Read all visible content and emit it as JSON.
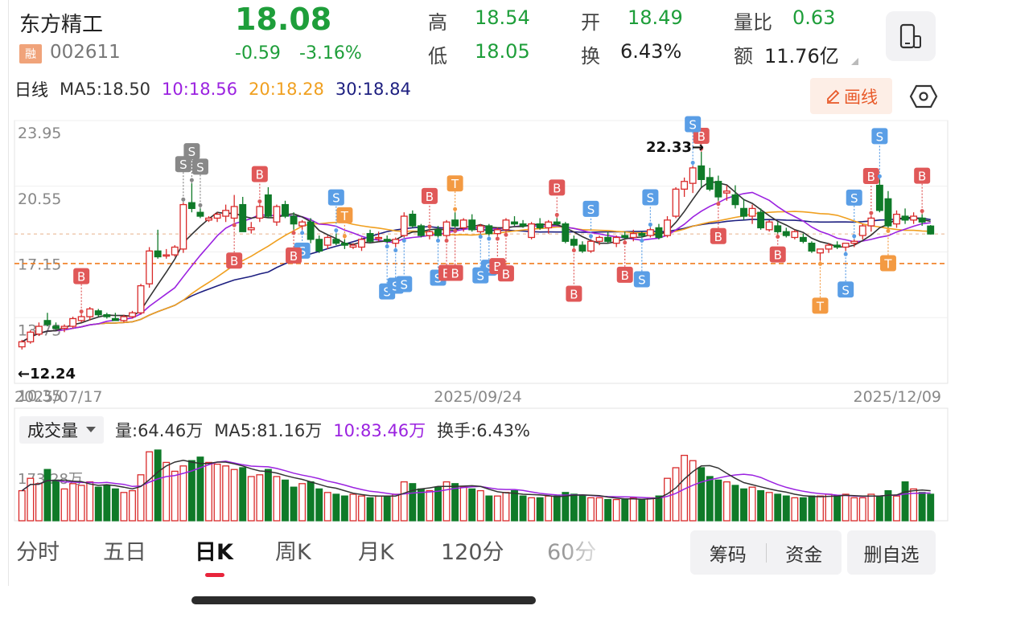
{
  "header": {
    "stock_name": "东方精工",
    "badge": "融",
    "stock_code": "002611",
    "price": "18.08",
    "change": "-0.59",
    "change_pct": "-3.16%",
    "high_label": "高",
    "high": "18.54",
    "low_label": "低",
    "low": "18.05",
    "open_label": "开",
    "open": "18.49",
    "turnover_label": "换",
    "turnover": "6.43%",
    "vol_ratio_label": "量比",
    "vol_ratio": "0.63",
    "amount_label": "额",
    "amount": "11.76亿"
  },
  "ma": {
    "period_label": "日线",
    "ma5": "MA5:18.50",
    "ma10": "10:18.56",
    "ma20": "20:18.28",
    "ma30": "30:18.84"
  },
  "toolbar": {
    "draw_label": "画线"
  },
  "kchart": {
    "y_labels": [
      "23.95",
      "20.55",
      "17.15",
      "13.75",
      "10.35"
    ],
    "max_label": "22.33→",
    "min_label": "←12.24",
    "dates": [
      "2025/07/17",
      "2025/09/24",
      "2025/12/09"
    ]
  },
  "volume": {
    "select_label": "成交量",
    "vol": "量:64.46万",
    "ma5": "MA5:81.16万",
    "ma10": "10:83.46万",
    "turnover": "换手:6.43%",
    "y_label": "173.28万"
  },
  "tabs": [
    "分时",
    "五日",
    "日K",
    "周K",
    "月K",
    "120分",
    "60分"
  ],
  "active_tab": "日K",
  "buttons": {
    "chips": "筹码",
    "funds": "资金",
    "remove_watch": "删自选"
  },
  "colors": {
    "up": "#d92a2a",
    "down": "#0f7a28",
    "ma5": "#333333",
    "ma10": "#9b22e0",
    "ma20": "#f0a020",
    "ma30": "#1d1f80",
    "buy": "#e05858",
    "sell": "#5a9ee6",
    "t": "#f39a42"
  },
  "chart_data": {
    "type": "candlestick",
    "x_start": "2025/07/17",
    "x_end": "2025/12/09",
    "ylim": [
      10.35,
      23.95
    ],
    "max_marker": 22.33,
    "min_marker": 12.24,
    "ohlc": [
      [
        12.24,
        12.6,
        12.1,
        12.5
      ],
      [
        12.5,
        13.1,
        12.4,
        13.0
      ],
      [
        12.9,
        13.5,
        12.8,
        13.3
      ],
      [
        13.6,
        14.0,
        13.3,
        13.4
      ],
      [
        13.3,
        13.5,
        13.1,
        13.2
      ],
      [
        13.2,
        13.4,
        13.0,
        13.3
      ],
      [
        13.3,
        13.8,
        13.2,
        13.7
      ],
      [
        13.6,
        13.9,
        13.5,
        13.8
      ],
      [
        13.8,
        14.3,
        13.6,
        14.2
      ],
      [
        14.1,
        14.2,
        13.8,
        13.9
      ],
      [
        13.9,
        14.0,
        13.7,
        13.8
      ],
      [
        13.7,
        14.0,
        13.6,
        13.6
      ],
      [
        13.6,
        13.9,
        13.5,
        13.8
      ],
      [
        13.8,
        14.1,
        13.7,
        14.0
      ],
      [
        14.0,
        15.5,
        13.9,
        15.4
      ],
      [
        15.5,
        17.4,
        15.3,
        17.2
      ],
      [
        17.2,
        18.3,
        16.8,
        16.9
      ],
      [
        17.0,
        17.3,
        16.8,
        17.0
      ],
      [
        17.0,
        17.5,
        16.9,
        17.4
      ],
      [
        17.3,
        19.7,
        17.1,
        19.6
      ],
      [
        19.7,
        20.7,
        19.2,
        19.4
      ],
      [
        19.2,
        19.4,
        18.9,
        19.0
      ],
      [
        18.8,
        19.0,
        18.7,
        18.9
      ],
      [
        18.9,
        19.2,
        18.7,
        19.1
      ],
      [
        19.0,
        19.6,
        18.7,
        19.3
      ],
      [
        18.9,
        20.1,
        18.7,
        19.5
      ],
      [
        19.6,
        20.0,
        18.3,
        18.2
      ],
      [
        18.3,
        18.7,
        18.1,
        18.4
      ],
      [
        18.9,
        19.6,
        18.7,
        19.5
      ],
      [
        20.1,
        20.5,
        18.9,
        19.0
      ],
      [
        18.7,
        19.6,
        18.5,
        19.5
      ],
      [
        19.6,
        19.8,
        18.9,
        19.0
      ],
      [
        19.0,
        19.2,
        18.3,
        18.6
      ],
      [
        18.5,
        18.8,
        18.3,
        18.7
      ],
      [
        18.7,
        18.9,
        17.6,
        17.8
      ],
      [
        17.8,
        18.0,
        17.1,
        17.2
      ],
      [
        17.5,
        18.0,
        17.3,
        17.9
      ],
      [
        17.8,
        18.1,
        17.5,
        17.6
      ],
      [
        17.6,
        17.8,
        17.3,
        17.5
      ],
      [
        17.4,
        17.6,
        17.3,
        17.5
      ],
      [
        17.4,
        17.9,
        17.2,
        17.8
      ],
      [
        18.1,
        18.3,
        17.6,
        17.7
      ],
      [
        17.9,
        18.2,
        17.7,
        17.9
      ],
      [
        17.8,
        18.0,
        17.6,
        17.7
      ],
      [
        17.6,
        17.9,
        17.4,
        17.8
      ],
      [
        18.0,
        19.2,
        17.9,
        19.0
      ],
      [
        19.1,
        19.3,
        18.4,
        18.5
      ],
      [
        18.5,
        18.6,
        17.9,
        18.0
      ],
      [
        18.0,
        18.3,
        17.8,
        18.2
      ],
      [
        18.3,
        18.5,
        17.9,
        18.0
      ],
      [
        18.0,
        18.8,
        17.9,
        18.7
      ],
      [
        18.8,
        19.2,
        18.4,
        18.5
      ],
      [
        18.4,
        18.9,
        18.2,
        18.8
      ],
      [
        18.8,
        19.1,
        18.2,
        18.3
      ],
      [
        18.2,
        18.6,
        18.1,
        18.5
      ],
      [
        18.5,
        18.6,
        18.0,
        18.1
      ],
      [
        18.1,
        18.4,
        18.0,
        18.3
      ],
      [
        18.3,
        18.9,
        18.2,
        18.8
      ],
      [
        18.7,
        19.0,
        18.5,
        18.6
      ],
      [
        18.6,
        18.8,
        18.4,
        18.5
      ],
      [
        17.9,
        18.7,
        17.8,
        18.6
      ],
      [
        18.6,
        18.9,
        18.3,
        18.4
      ],
      [
        18.4,
        18.8,
        18.1,
        18.7
      ],
      [
        18.7,
        18.9,
        18.5,
        18.6
      ],
      [
        18.6,
        18.7,
        17.6,
        17.7
      ],
      [
        17.8,
        18.0,
        17.4,
        17.5
      ],
      [
        17.5,
        17.7,
        17.1,
        17.2
      ],
      [
        17.2,
        17.8,
        17.1,
        17.7
      ],
      [
        17.7,
        18.0,
        17.5,
        17.9
      ],
      [
        17.9,
        18.2,
        17.6,
        17.7
      ],
      [
        17.6,
        18.0,
        17.4,
        17.9
      ],
      [
        18.0,
        18.2,
        17.8,
        17.9
      ],
      [
        17.9,
        18.3,
        17.7,
        18.1
      ],
      [
        18.1,
        18.2,
        17.9,
        18.0
      ],
      [
        18.0,
        18.4,
        17.9,
        18.3
      ],
      [
        18.4,
        18.6,
        17.8,
        17.9
      ],
      [
        18.0,
        19.0,
        17.9,
        18.8
      ],
      [
        19.0,
        20.5,
        18.9,
        20.4
      ],
      [
        20.4,
        21.0,
        20.0,
        20.8
      ],
      [
        20.7,
        21.6,
        20.2,
        21.5
      ],
      [
        21.6,
        22.33,
        20.5,
        20.9
      ],
      [
        21.0,
        21.5,
        20.3,
        20.4
      ],
      [
        20.8,
        21.1,
        19.8,
        20.0
      ],
      [
        20.2,
        20.6,
        19.8,
        20.3
      ],
      [
        20.1,
        20.6,
        19.4,
        19.6
      ],
      [
        19.4,
        19.9,
        18.8,
        19.0
      ],
      [
        19.0,
        19.6,
        18.6,
        19.4
      ],
      [
        19.2,
        19.4,
        18.3,
        18.4
      ],
      [
        18.3,
        18.8,
        18.2,
        18.7
      ],
      [
        18.5,
        18.7,
        18.1,
        18.2
      ],
      [
        18.2,
        18.4,
        17.9,
        18.0
      ],
      [
        17.9,
        18.3,
        17.8,
        18.2
      ],
      [
        17.9,
        18.1,
        17.6,
        17.7
      ],
      [
        17.6,
        17.7,
        17.1,
        17.2
      ],
      [
        17.1,
        17.3,
        16.7,
        17.3
      ],
      [
        17.3,
        17.6,
        17.1,
        17.5
      ],
      [
        17.5,
        17.7,
        17.3,
        17.4
      ],
      [
        17.4,
        17.6,
        17.2,
        17.6
      ],
      [
        17.6,
        17.8,
        17.4,
        17.7
      ],
      [
        18.0,
        18.6,
        17.8,
        18.5
      ],
      [
        18.5,
        19.0,
        18.2,
        18.9
      ],
      [
        20.6,
        20.9,
        19.2,
        19.3
      ],
      [
        19.9,
        20.3,
        18.4,
        18.5
      ],
      [
        18.6,
        19.3,
        18.4,
        19.1
      ],
      [
        19.0,
        19.4,
        18.6,
        18.8
      ],
      [
        18.8,
        19.2,
        18.6,
        19.0
      ],
      [
        18.9,
        19.1,
        18.5,
        18.7
      ],
      [
        18.49,
        18.54,
        18.05,
        18.08
      ]
    ],
    "volume_max_label": 173.28,
    "volumes": [
      85,
      120,
      105,
      145,
      115,
      90,
      105,
      100,
      110,
      95,
      100,
      90,
      80,
      85,
      130,
      195,
      200,
      165,
      140,
      155,
      170,
      180,
      165,
      160,
      155,
      145,
      150,
      125,
      130,
      145,
      125,
      115,
      95,
      105,
      110,
      90,
      80,
      75,
      70,
      75,
      70,
      65,
      70,
      70,
      75,
      110,
      105,
      90,
      85,
      95,
      110,
      105,
      95,
      90,
      85,
      70,
      70,
      80,
      85,
      70,
      65,
      65,
      70,
      70,
      80,
      75,
      70,
      65,
      65,
      60,
      60,
      60,
      65,
      60,
      65,
      70,
      120,
      150,
      185,
      170,
      150,
      125,
      115,
      110,
      100,
      90,
      95,
      85,
      80,
      75,
      70,
      65,
      65,
      70,
      70,
      75,
      70,
      75,
      65,
      65,
      75,
      70,
      85,
      70,
      110,
      90,
      80,
      75,
      85,
      75,
      70,
      64.46
    ]
  }
}
